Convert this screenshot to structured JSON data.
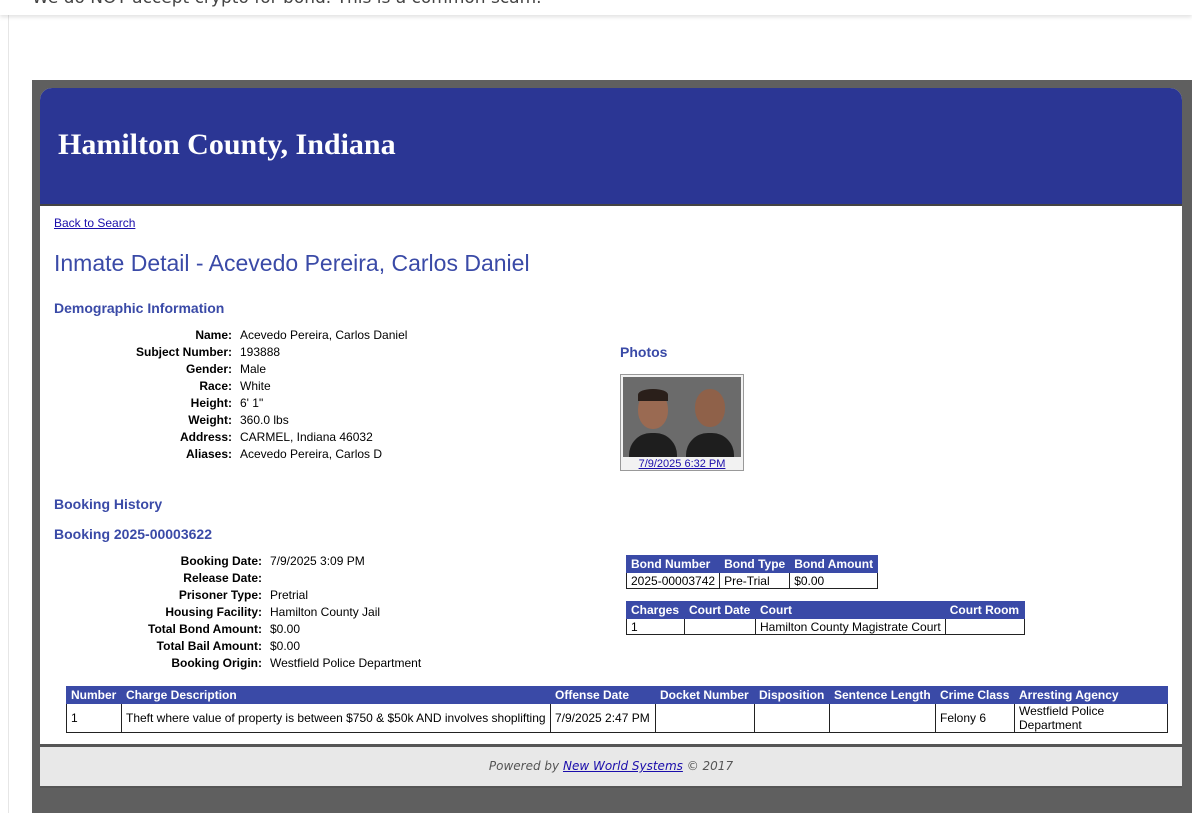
{
  "top_notice": "We do NOT accept crypto for bond.  This is a common scam.",
  "header": {
    "title": "Hamilton County, Indiana"
  },
  "back_link": "Back to Search",
  "page_title": "Inmate Detail - Acevedo Pereira, Carlos Daniel",
  "demographics": {
    "heading": "Demographic Information",
    "fields": [
      {
        "label": "Name:",
        "value": "Acevedo Pereira, Carlos Daniel"
      },
      {
        "label": "Subject Number:",
        "value": "193888"
      },
      {
        "label": "Gender:",
        "value": "Male"
      },
      {
        "label": "Race:",
        "value": "White"
      },
      {
        "label": "Height:",
        "value": "6' 1\""
      },
      {
        "label": "Weight:",
        "value": "360.0 lbs"
      },
      {
        "label": "Address:",
        "value": "CARMEL, Indiana 46032"
      },
      {
        "label": "Aliases:",
        "value": "Acevedo Pereira, Carlos D"
      }
    ]
  },
  "photos": {
    "heading": "Photos",
    "link": "7/9/2025 6:32 PM"
  },
  "booking_history": {
    "heading": "Booking History",
    "booking_heading": "Booking 2025-00003622",
    "fields": [
      {
        "label": "Booking Date:",
        "value": "7/9/2025 3:09 PM"
      },
      {
        "label": "Release Date:",
        "value": ""
      },
      {
        "label": "Prisoner Type:",
        "value": "Pretrial"
      },
      {
        "label": "Housing Facility:",
        "value": "Hamilton County Jail"
      },
      {
        "label": "Total Bond Amount:",
        "value": "$0.00"
      },
      {
        "label": "Total Bail Amount:",
        "value": "$0.00"
      },
      {
        "label": "Booking Origin:",
        "value": "Westfield Police Department"
      }
    ]
  },
  "bond_table": {
    "headers": [
      "Bond Number",
      "Bond Type",
      "Bond Amount"
    ],
    "rows": [
      [
        "2025-00003742",
        "Pre-Trial",
        "$0.00"
      ]
    ]
  },
  "court_table": {
    "headers": [
      "Charges",
      "Court Date",
      "Court",
      "Court Room"
    ],
    "rows": [
      [
        "1",
        "",
        "Hamilton County Magistrate Court",
        ""
      ]
    ]
  },
  "charges_table": {
    "headers": [
      "Number",
      "Charge Description",
      "Offense Date",
      "Docket Number",
      "Disposition",
      "Sentence Length",
      "Crime Class",
      "Arresting Agency"
    ],
    "rows": [
      [
        "1",
        "Theft where value of property is between $750 & $50k AND involves shoplifting",
        "7/9/2025 2:47 PM",
        "",
        "",
        "",
        "Felony 6",
        "Westfield Police Department"
      ]
    ]
  },
  "footer": {
    "prefix": "Powered by",
    "link": "New World Systems",
    "suffix": "© 2017"
  },
  "colors": {
    "header_bg": "#2b3694",
    "accent": "#3a4aa7",
    "link": "#1a0dab",
    "frame": "#5f5f5f"
  }
}
